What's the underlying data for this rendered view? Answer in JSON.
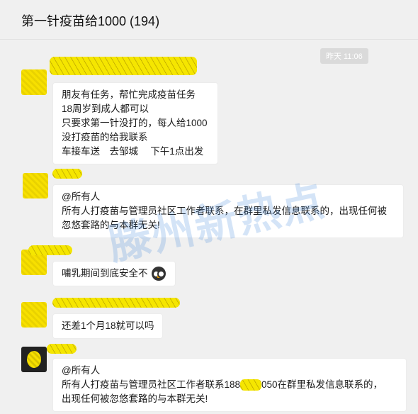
{
  "header": {
    "title": "第一针疫苗给1000 (194)"
  },
  "chat": {
    "timestamp": "昨天 11:06",
    "messages": [
      {
        "lines": [
          "朋友有任务，帮忙完成疫苗任务",
          "18周岁到成人都可以",
          "只要求第一针没打的，每人给1000",
          "没打疫苗的给我联系",
          "车接车送　去邹城　 下午1点出发"
        ]
      },
      {
        "mention": "@所有人",
        "text": "所有人打疫苗与管理员社区工作者联系，在群里私发信息联系的，出现任何被忽悠套路的与本群无关!"
      },
      {
        "text": "哺乳期间到底安全不"
      },
      {
        "text": "还差1个月18就可以吗"
      },
      {
        "mention": "@所有人",
        "text_before": "所有人打疫苗与管理员社区工作者联系188",
        "text_after": "050在群里私发信息联系的，",
        "text_line2": "出现任何被忽悠套路的与本群无关!"
      }
    ]
  },
  "watermark": "滕州新热点"
}
